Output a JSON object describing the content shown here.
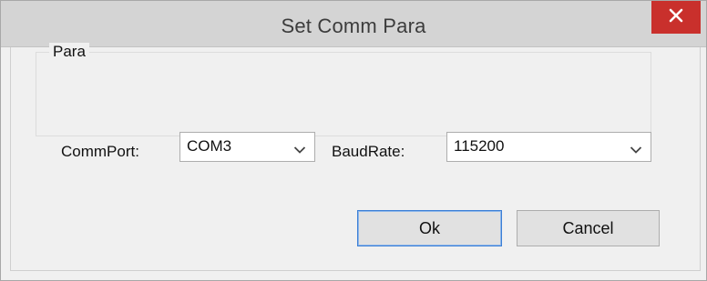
{
  "window": {
    "title": "Set Comm Para"
  },
  "group": {
    "label": "Para"
  },
  "comm_port": {
    "label": "CommPort:",
    "value": "COM3"
  },
  "baud_rate": {
    "label": "BaudRate:",
    "value": "115200"
  },
  "buttons": {
    "ok": "Ok",
    "cancel": "Cancel"
  },
  "colors": {
    "close_button": "#c9302c",
    "default_button_border": "#3c7fd6"
  },
  "icons": {
    "close": "close-icon",
    "dropdown": "chevron-down-icon"
  }
}
